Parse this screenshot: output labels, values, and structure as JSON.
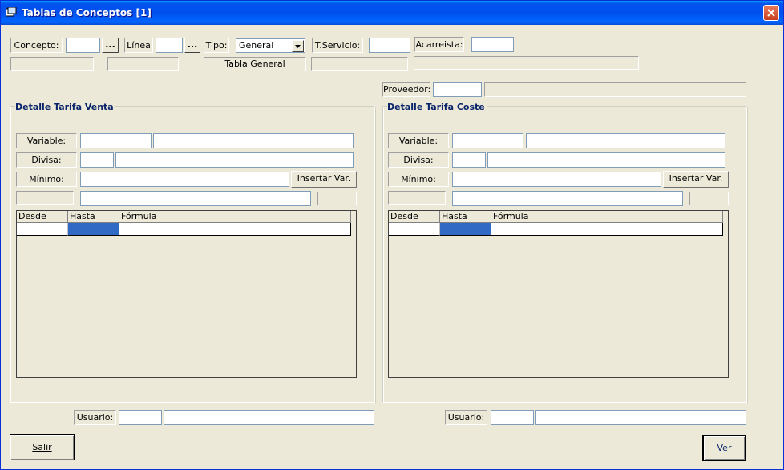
{
  "window": {
    "title": "Tablas de Conceptos [1]"
  },
  "header": {
    "concepto_label": "Concepto:",
    "concepto_value": "",
    "browse_label": "...",
    "linea_label": "Línea",
    "linea_value": "",
    "tipo_label": "Tipo:",
    "tipo_selected": "General",
    "tservicio_label": "T.Servicio:",
    "tservicio_value": "",
    "acarreista_label": "Acarreista:",
    "acarreista_value": "",
    "tabla_label": "Tabla General",
    "proveedor_label": "Proveedor:",
    "proveedor_value": ""
  },
  "venta": {
    "title": "Detalle Tarifa Venta",
    "variable_label": "Variable:",
    "divisa_label": "Divisa:",
    "minimo_label": "Mínimo:",
    "insertar_label": "Insertar Var.",
    "grid_columns": [
      "Desde",
      "Hasta",
      "Fórmula"
    ],
    "usuario_label": "Usuario:"
  },
  "coste": {
    "title": "Detalle Tarifa Coste",
    "variable_label": "Variable:",
    "divisa_label": "Divisa:",
    "minimo_label": "Mínimo:",
    "insertar_label": "Insertar Var.",
    "grid_columns": [
      "Desde",
      "Hasta",
      "Fórmula"
    ],
    "usuario_label": "Usuario:"
  },
  "footer": {
    "salir_label": "Salir",
    "ver_label": "Ver"
  }
}
